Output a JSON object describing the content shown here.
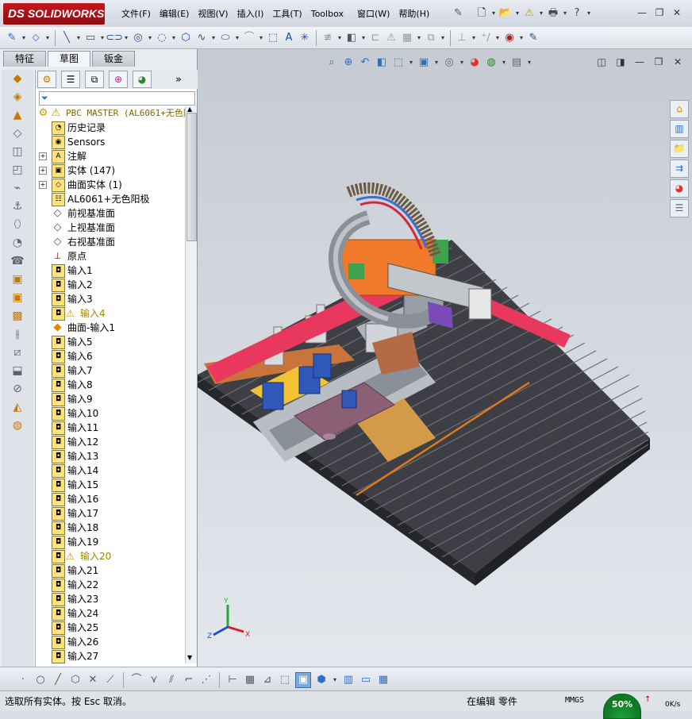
{
  "app": {
    "logo_ds": "DS",
    "logo_text": "SOLIDWORKS"
  },
  "menus": [
    "文件(F)",
    "编辑(E)",
    "视图(V)",
    "插入(I)",
    "工具(T)",
    "Toolbox",
    "窗口(W)",
    "帮助(H)"
  ],
  "window_controls": {
    "minimize": "—",
    "restore": "❐",
    "close": "✕"
  },
  "panel_tabs": [
    "特征",
    "草图",
    "钣金"
  ],
  "panel_active_tab": "草图",
  "tree": {
    "root": "PBC MASTER  (AL6061+无色阳",
    "items": [
      {
        "label": "历史记录",
        "icon": "history-icon"
      },
      {
        "label": "Sensors",
        "icon": "sensors-icon"
      },
      {
        "label": "注解",
        "icon": "annotation-icon",
        "expand": "+"
      },
      {
        "label": "实体 (147)",
        "icon": "solid-bodies-icon",
        "expand": "+"
      },
      {
        "label": "曲面实体 (1)",
        "icon": "surface-bodies-icon",
        "expand": "+"
      },
      {
        "label": "AL6061+无色阳极",
        "icon": "material-icon"
      },
      {
        "label": "前视基准面",
        "icon": "plane-icon"
      },
      {
        "label": "上视基准面",
        "icon": "plane-icon"
      },
      {
        "label": "右视基准面",
        "icon": "plane-icon"
      },
      {
        "label": "原点",
        "icon": "origin-icon"
      },
      {
        "label": "输入1",
        "icon": "import-icon"
      },
      {
        "label": "输入2",
        "icon": "import-icon"
      },
      {
        "label": "输入3",
        "icon": "import-icon"
      },
      {
        "label": "输入4",
        "icon": "import-icon",
        "warn": true
      },
      {
        "label": "曲面-输入1",
        "icon": "surface-import-icon"
      },
      {
        "label": "输入5",
        "icon": "import-icon"
      },
      {
        "label": "输入6",
        "icon": "import-icon"
      },
      {
        "label": "输入7",
        "icon": "import-icon"
      },
      {
        "label": "输入8",
        "icon": "import-icon"
      },
      {
        "label": "输入9",
        "icon": "import-icon"
      },
      {
        "label": "输入10",
        "icon": "import-icon"
      },
      {
        "label": "输入11",
        "icon": "import-icon"
      },
      {
        "label": "输入12",
        "icon": "import-icon"
      },
      {
        "label": "输入13",
        "icon": "import-icon"
      },
      {
        "label": "输入14",
        "icon": "import-icon"
      },
      {
        "label": "输入15",
        "icon": "import-icon"
      },
      {
        "label": "输入16",
        "icon": "import-icon"
      },
      {
        "label": "输入17",
        "icon": "import-icon"
      },
      {
        "label": "输入18",
        "icon": "import-icon"
      },
      {
        "label": "输入19",
        "icon": "import-icon"
      },
      {
        "label": "输入20",
        "icon": "import-icon",
        "warn": true
      },
      {
        "label": "输入21",
        "icon": "import-icon"
      },
      {
        "label": "输入22",
        "icon": "import-icon"
      },
      {
        "label": "输入23",
        "icon": "import-icon"
      },
      {
        "label": "输入24",
        "icon": "import-icon"
      },
      {
        "label": "输入25",
        "icon": "import-icon"
      },
      {
        "label": "输入26",
        "icon": "import-icon"
      },
      {
        "label": "输入27",
        "icon": "import-icon"
      }
    ]
  },
  "triad": {
    "x": "X",
    "y": "Y",
    "z": "Z"
  },
  "status": {
    "text": "选取所有实体。按 Esc 取消。",
    "mode": "在编辑 零件",
    "units": "MMGS",
    "net_percent": "50%",
    "net_rate": "0K/s"
  },
  "colors": {
    "accent": "#c4161c",
    "warning": "#c49a00"
  }
}
